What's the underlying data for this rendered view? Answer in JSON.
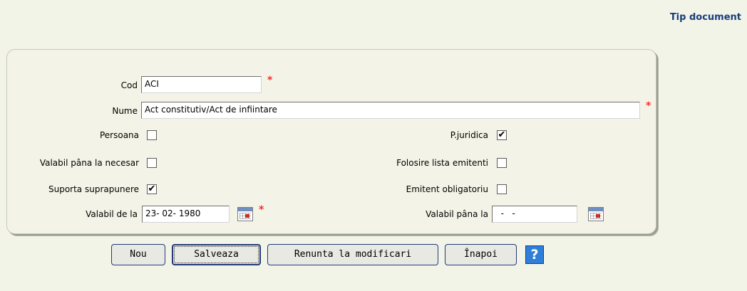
{
  "header": {
    "title": "Tip document"
  },
  "form": {
    "cod": {
      "label": "Cod",
      "value": "ACI",
      "required": "*"
    },
    "nume": {
      "label": "Nume",
      "value": "Act constitutiv/Act de infiintare",
      "required": "*"
    },
    "persoana": {
      "label": "Persoana",
      "checked": ""
    },
    "pjuridica": {
      "label": "P.juridica",
      "checked": "✔"
    },
    "valabil_necesar": {
      "label": "Valabil pâna la necesar",
      "checked": ""
    },
    "lista_emitenti": {
      "label": "Folosire lista emitenti",
      "checked": ""
    },
    "suprapunere": {
      "label": "Suporta suprapunere",
      "checked": "✔"
    },
    "emitent_obligatoriu": {
      "label": "Emitent obligatoriu",
      "checked": ""
    },
    "valabil_de_la": {
      "label": "Valabil de la",
      "value": "23- 02-  1980",
      "required": "*"
    },
    "valabil_pana_la": {
      "label": "Valabil pâna la",
      "value": "  -   -"
    }
  },
  "buttons": {
    "nou": "Nou",
    "salveaza": "Salveaza",
    "renunta": "Renunta la modificari",
    "inapoi": "Înapoi",
    "help": "?"
  },
  "icons": {
    "calendar": "calendar-icon",
    "help": "help-icon"
  },
  "colors": {
    "title": "#1a3d7a",
    "required": "#ff2a2a",
    "button_border": "#23397a",
    "help_bg": "#2f7fd8"
  }
}
